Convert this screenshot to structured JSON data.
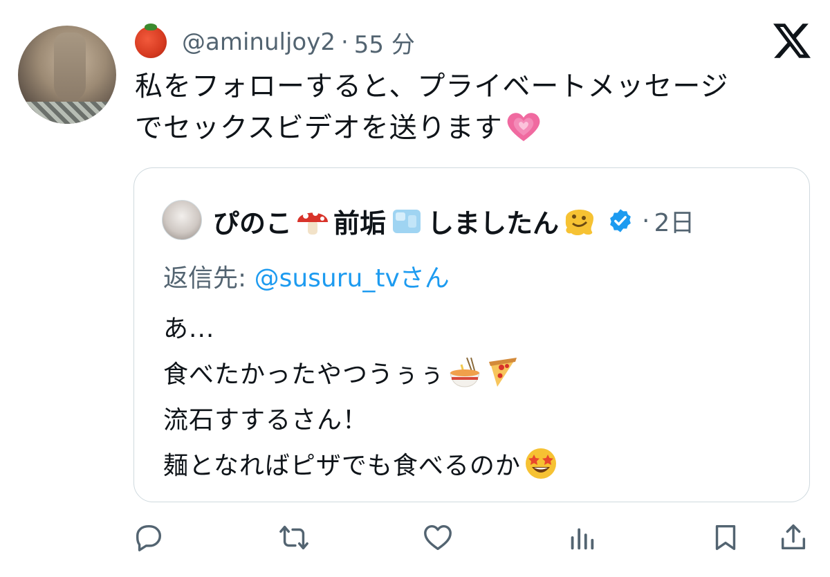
{
  "tweet": {
    "author_emoji": "tomato-emoji",
    "handle": "@aminuljoy2",
    "separator": "·",
    "time": "55 分",
    "text_lines": [
      "私をフォローすると、プライベートメッセージ",
      "でセックスビデオを送ります"
    ],
    "text_trailing_emoji": "growing-heart-emoji"
  },
  "quote": {
    "name_parts": [
      "ぴのこ",
      "前垢",
      "しましたん"
    ],
    "name_emojis": [
      "mushroom-emoji",
      "ice-cube-emoji",
      "melting-face-emoji"
    ],
    "verified": true,
    "separator": "·",
    "time": "2日",
    "reply_prefix": "返信先: ",
    "reply_mention": "@susuru_tv",
    "reply_suffix": "さん",
    "body_lines": [
      "あ...",
      "食べたかったやつうぅぅ",
      "流石すするさん！",
      "麺となればピザでも食べるのか"
    ],
    "body_emojis": [
      "ramen-emoji",
      "pizza-emoji",
      "star-struck-emoji"
    ]
  },
  "colors": {
    "text": "#0f1419",
    "secondary": "#536471",
    "accent": "#1d9bf0",
    "border": "#cfd9de"
  },
  "actions": [
    "reply-icon",
    "retweet-icon",
    "like-icon",
    "views-icon",
    "bookmark-icon",
    "share-icon"
  ]
}
